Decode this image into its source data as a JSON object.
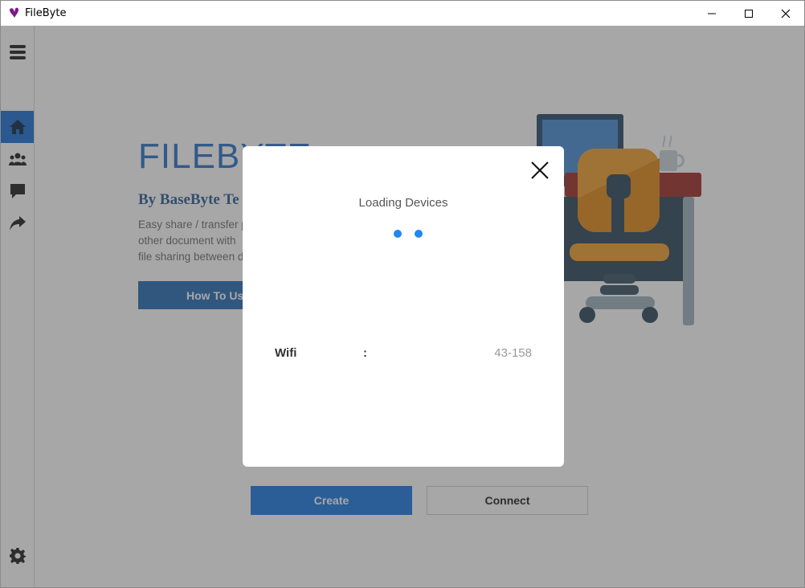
{
  "window": {
    "title": "FileByte",
    "icons": [
      "butterfly-logo-icon",
      "minimize-icon",
      "maximize-icon",
      "close-icon"
    ]
  },
  "sidebar": {
    "items": [
      {
        "icon": "menu-icon"
      },
      {
        "icon": "home-icon",
        "active": true
      },
      {
        "icon": "users-icon"
      },
      {
        "icon": "chat-icon"
      },
      {
        "icon": "share-icon"
      },
      {
        "icon": "settings-icon"
      }
    ]
  },
  "hero": {
    "title": "FILEBYTE",
    "subtitle": "By BaseByte Te",
    "desc_line1": "Easy share / transfer p",
    "desc_line2": "other document with",
    "desc_line3": "file sharing between d",
    "howto_label": "How To Us"
  },
  "actions": {
    "create_label": "Create",
    "connect_label": "Connect"
  },
  "modal": {
    "title": "Loading Devices",
    "row_label": "Wifi",
    "row_colon": ":",
    "row_value": "43-158"
  },
  "colors": {
    "accent": "#1e7ae0",
    "sidebar_active": "#1e6fd1",
    "hero_title": "#2a74c8",
    "spinner": "#1e88f0"
  }
}
